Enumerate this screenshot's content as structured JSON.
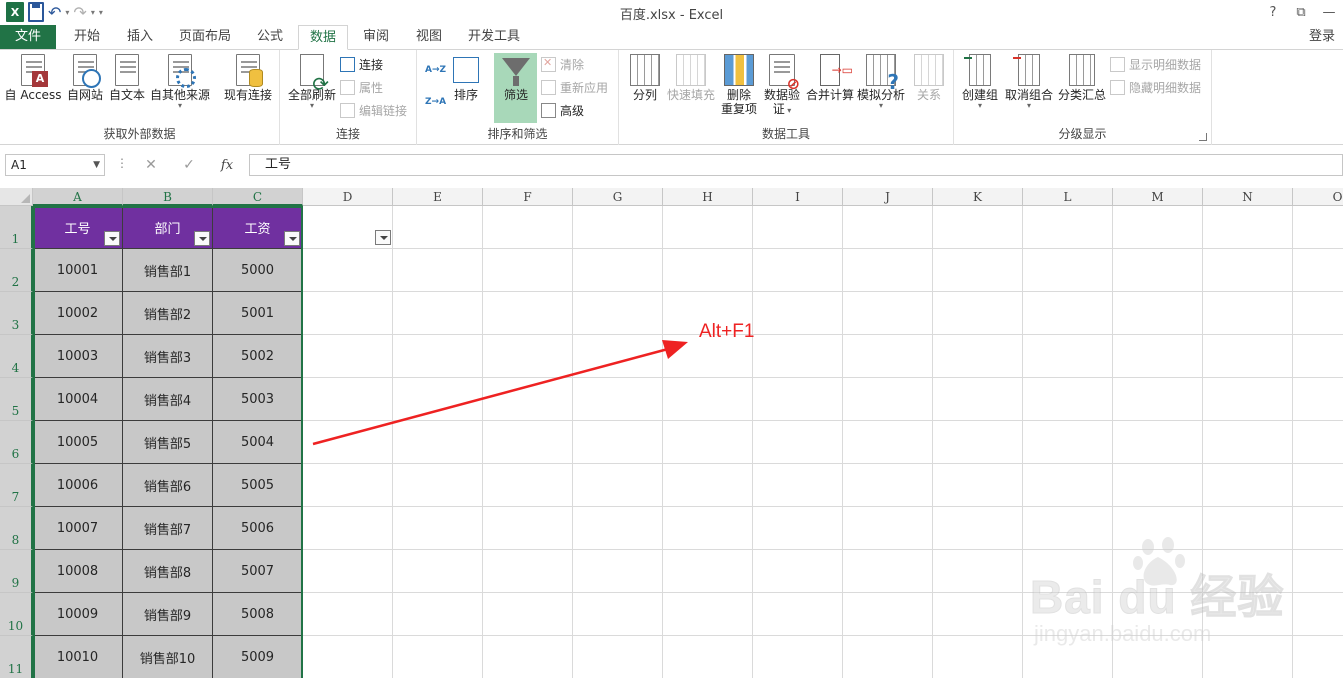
{
  "titlebar": {
    "title": "百度.xlsx - Excel",
    "excel_logo": "X",
    "help": "?",
    "ribbon_display": "⧉",
    "minimize": "—",
    "qat_more": "▾"
  },
  "tabs": [
    {
      "label": "文件"
    },
    {
      "label": "开始"
    },
    {
      "label": "插入"
    },
    {
      "label": "页面布局"
    },
    {
      "label": "公式"
    },
    {
      "label": "数据",
      "active": true
    },
    {
      "label": "审阅"
    },
    {
      "label": "视图"
    },
    {
      "label": "开发工具"
    }
  ],
  "login": "登录",
  "ribbon": {
    "external": {
      "label": "获取外部数据",
      "access": "自 Access",
      "web": "自网站",
      "text": "自文本",
      "other": "自其他来源",
      "existing": "现有连接"
    },
    "connections": {
      "label": "连接",
      "refresh_all": "全部刷新",
      "connections": "连接",
      "properties": "属性",
      "edit_links": "编辑链接"
    },
    "sortfilter": {
      "label": "排序和筛选",
      "sort_az": "A→Z",
      "sort_za": "Z→A",
      "sort": "排序",
      "filter": "筛选",
      "clear": "清除",
      "reapply": "重新应用",
      "advanced": "高级"
    },
    "datatools": {
      "label": "数据工具",
      "text_to_columns": "分列",
      "flash_fill": "快速填充",
      "remove_dup_1": "删除",
      "remove_dup_2": "重复项",
      "validation_1": "数据验",
      "validation_2": "证",
      "consolidate": "合并计算",
      "whatif": "模拟分析",
      "relationships": "关系"
    },
    "outline": {
      "label": "分级显示",
      "group": "创建组",
      "ungroup": "取消组合",
      "subtotal": "分类汇总",
      "show_detail": "显示明细数据",
      "hide_detail": "隐藏明细数据"
    }
  },
  "formula_bar": {
    "name_box": "A1",
    "cancel": "✕",
    "enter": "✓",
    "fx": "fx",
    "dots": "⋮",
    "value": "工号"
  },
  "columns": [
    "A",
    "B",
    "C",
    "D",
    "E",
    "F",
    "G",
    "H",
    "I",
    "J",
    "K",
    "L",
    "M",
    "N",
    "O"
  ],
  "rows": [
    "1",
    "2",
    "3",
    "4",
    "5",
    "6",
    "7",
    "8",
    "9",
    "10",
    "11"
  ],
  "table": {
    "headers": [
      "工号",
      "部门",
      "工资"
    ],
    "rows": [
      [
        "10001",
        "销售部1",
        "5000"
      ],
      [
        "10002",
        "销售部2",
        "5001"
      ],
      [
        "10003",
        "销售部3",
        "5002"
      ],
      [
        "10004",
        "销售部4",
        "5003"
      ],
      [
        "10005",
        "销售部5",
        "5004"
      ],
      [
        "10006",
        "销售部6",
        "5005"
      ],
      [
        "10007",
        "销售部7",
        "5006"
      ],
      [
        "10008",
        "销售部8",
        "5007"
      ],
      [
        "10009",
        "销售部9",
        "5008"
      ],
      [
        "10010",
        "销售部10",
        "5009"
      ]
    ]
  },
  "annotation": {
    "text": "Alt+F1",
    "color": "#ee2222"
  },
  "watermark": {
    "main": "Bai du 经验",
    "sub": "jingyan.baidu.com"
  },
  "colors": {
    "excel_green": "#217346",
    "header_purple": "#7030a0",
    "data_gray": "#c8c8c8"
  }
}
